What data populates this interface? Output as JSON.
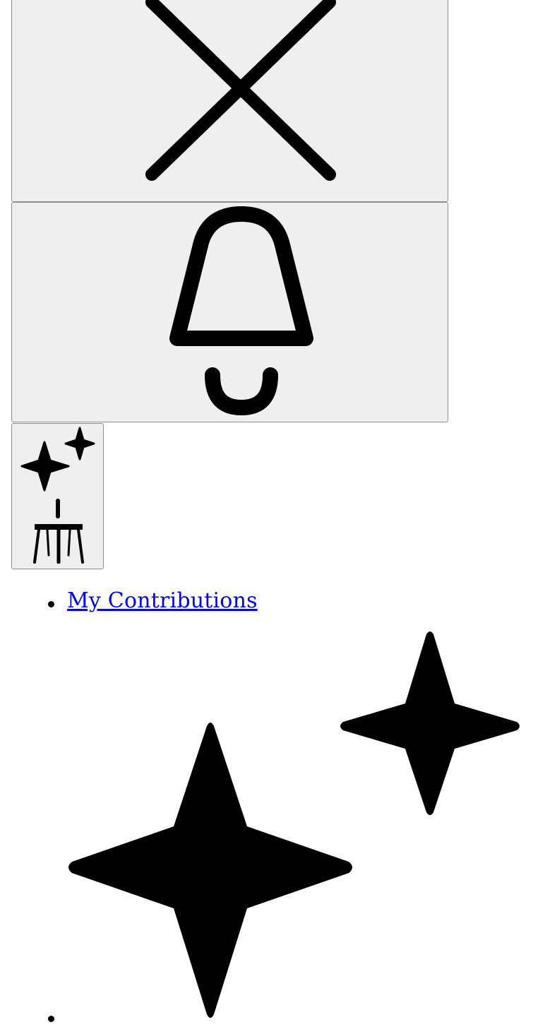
{
  "toolbar": {
    "close_button": {
      "icon": "close-icon"
    },
    "notifications_button": {
      "icon": "bell-icon"
    },
    "assistant_button": {
      "icons": [
        "sparkles-icon",
        "chair-icon"
      ]
    }
  },
  "menu": {
    "items": [
      {
        "label": "My Contributions",
        "type": "link"
      },
      {
        "label": "",
        "icon": "sparkles-icon"
      }
    ]
  },
  "colors": {
    "button_background": "#efefef",
    "button_border": "#8f8f8f",
    "link": "#0000ee",
    "icon": "#000000"
  }
}
